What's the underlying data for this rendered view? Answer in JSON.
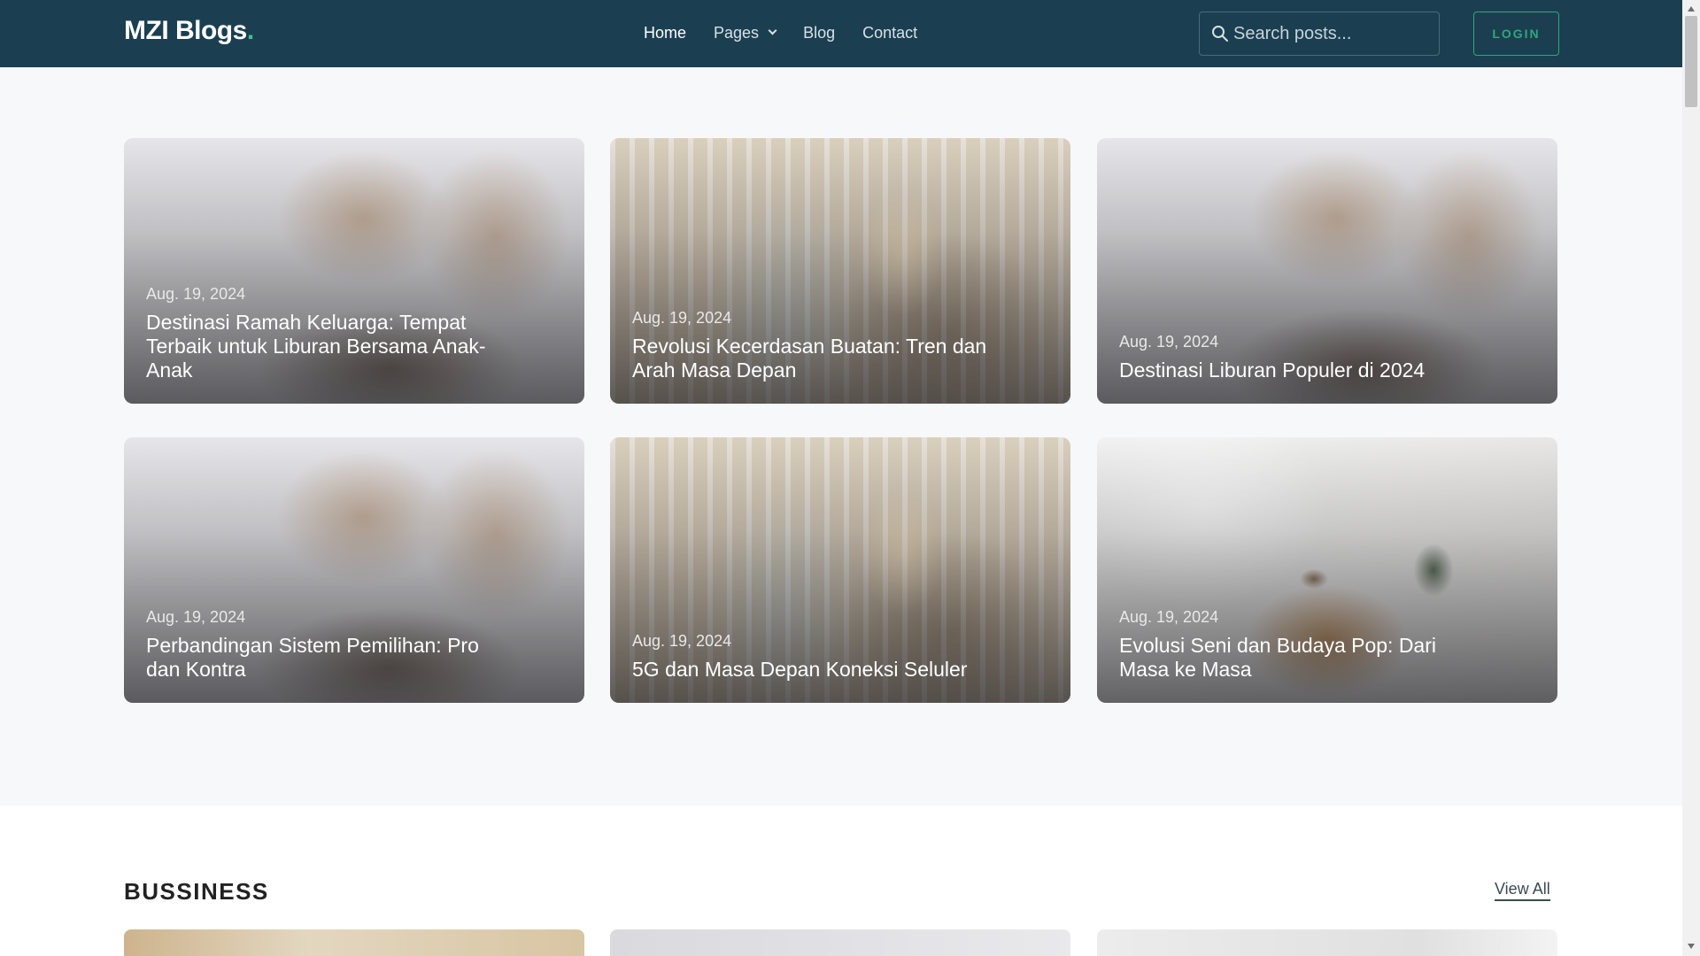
{
  "header": {
    "brand": "MZI Blogs",
    "brand_dot": ".",
    "nav": [
      {
        "label": "Home"
      },
      {
        "label": "Pages"
      },
      {
        "label": "Blog"
      },
      {
        "label": "Contact"
      }
    ],
    "search_placeholder": "Search posts...",
    "search_value": "",
    "login_label": "LOGIN"
  },
  "featured": {
    "posts": [
      {
        "date": "Aug. 19, 2024",
        "title": "Destinasi Ramah Keluarga: Tempat Terbaik untuk Liburan Bersama Anak-Anak",
        "image": "pampas-grass-vase"
      },
      {
        "date": "Aug. 19, 2024",
        "title": "Revolusi Kecerdasan Buatan: Tren dan Arah Masa Depan",
        "image": "bicycle-blanket"
      },
      {
        "date": "Aug. 19, 2024",
        "title": "Destinasi Liburan Populer di 2024",
        "image": "pampas-grass-vase"
      },
      {
        "date": "Aug. 19, 2024",
        "title": "Perbandingan Sistem Pemilihan: Pro dan Kontra",
        "image": "pampas-grass-vase"
      },
      {
        "date": "Aug. 19, 2024",
        "title": "5G dan Masa Depan Koneksi Seluler",
        "image": "bicycle-blanket"
      },
      {
        "date": "Aug. 19, 2024",
        "title": "Evolusi Seni dan Budaya Pop: Dari Masa ke Masa",
        "image": "coffee-table"
      }
    ]
  },
  "business": {
    "title": "BUSSINESS",
    "view_all": "View All"
  },
  "colors": {
    "navbar": "#1b3f51",
    "accent": "#2ea879",
    "page_bg": "#f7f8fa"
  }
}
